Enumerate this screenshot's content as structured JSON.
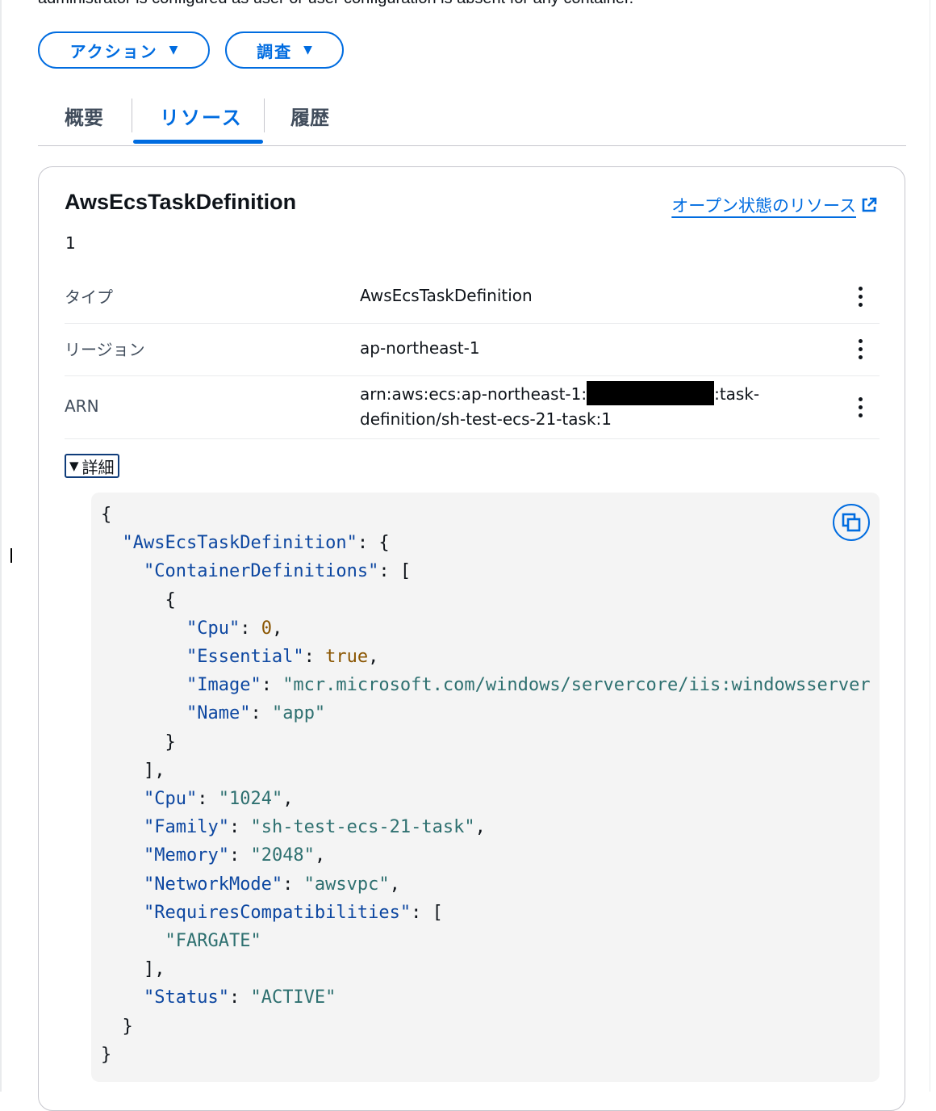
{
  "top_text": "administrator is configured as user or user configuration is absent for any container.",
  "buttons": {
    "action": "アクション",
    "investigate": "調査"
  },
  "tabs": [
    "概要",
    "リソース",
    "履歴"
  ],
  "active_tab": "リソース",
  "card": {
    "title": "AwsEcsTaskDefinition",
    "link": "オープン状態のリソース",
    "count": "1",
    "rows": [
      {
        "key": "タイプ",
        "value": "AwsEcsTaskDefinition"
      },
      {
        "key": "リージョン",
        "value": "ap-northeast-1"
      },
      {
        "key": "ARN",
        "value_prefix": "arn:aws:ecs:ap-northeast-1:",
        "value_suffix": ":task-",
        "value_line2": "definition/sh-test-ecs-21-task:1"
      }
    ],
    "details_label": "詳細"
  },
  "code": {
    "l0": "{",
    "l1k": "\"AwsEcsTaskDefinition\"",
    "l2k": "\"ContainerDefinitions\"",
    "cpu0k": "\"Cpu\"",
    "cpu0v": "0",
    "essk": "\"Essential\"",
    "essv": "true",
    "imgk": "\"Image\"",
    "imgv": "\"mcr.microsoft.com/windows/servercore/iis:windowsserver",
    "namek": "\"Name\"",
    "namev": "\"app\"",
    "cpuk": "\"Cpu\"",
    "cpuv": "\"1024\"",
    "famk": "\"Family\"",
    "famv": "\"sh-test-ecs-21-task\"",
    "memk": "\"Memory\"",
    "memv": "\"2048\"",
    "netk": "\"NetworkMode\"",
    "netv": "\"awsvpc\"",
    "reqk": "\"RequiresCompatibilities\"",
    "reqv": "\"FARGATE\"",
    "statk": "\"Status\"",
    "statv": "\"ACTIVE\""
  }
}
